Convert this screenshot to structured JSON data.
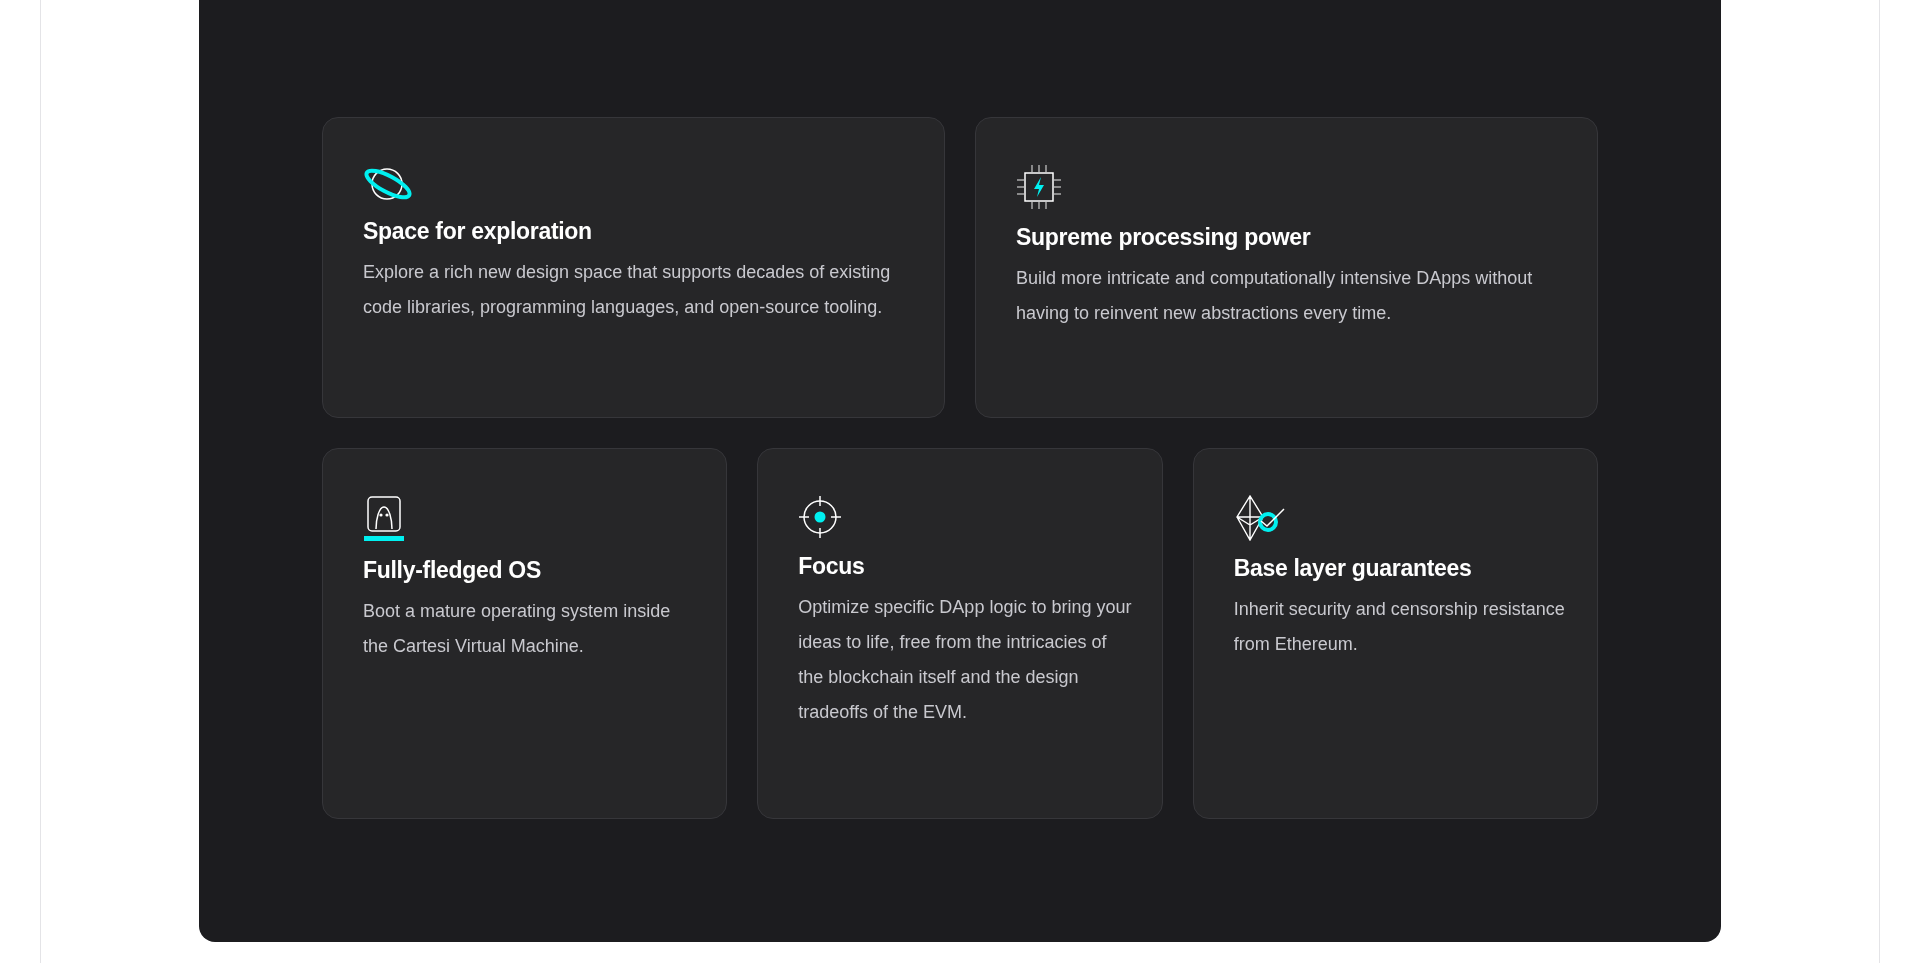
{
  "features": [
    {
      "kind": "planet",
      "title": "Space for exploration",
      "text": "Explore a rich new design space that supports decades of existing code libraries, programming languages, and open-source tooling."
    },
    {
      "kind": "chip",
      "title": "Supreme processing power",
      "text": "Build more intricate and computationally intensive DApps without having to reinvent new abstractions every time."
    },
    {
      "kind": "os",
      "title": "Fully-fledged OS",
      "text": "Boot a mature operating system inside the Cartesi Virtual Machine."
    },
    {
      "kind": "focus",
      "title": "Focus",
      "text": "Optimize specific DApp logic to bring your ideas to life, free from the intricacies of the blockchain itself and the design tradeoffs of the EVM."
    },
    {
      "kind": "ethereum",
      "title": "Base layer guarantees",
      "text": "Inherit security and censorship resistance from Ethereum."
    }
  ]
}
